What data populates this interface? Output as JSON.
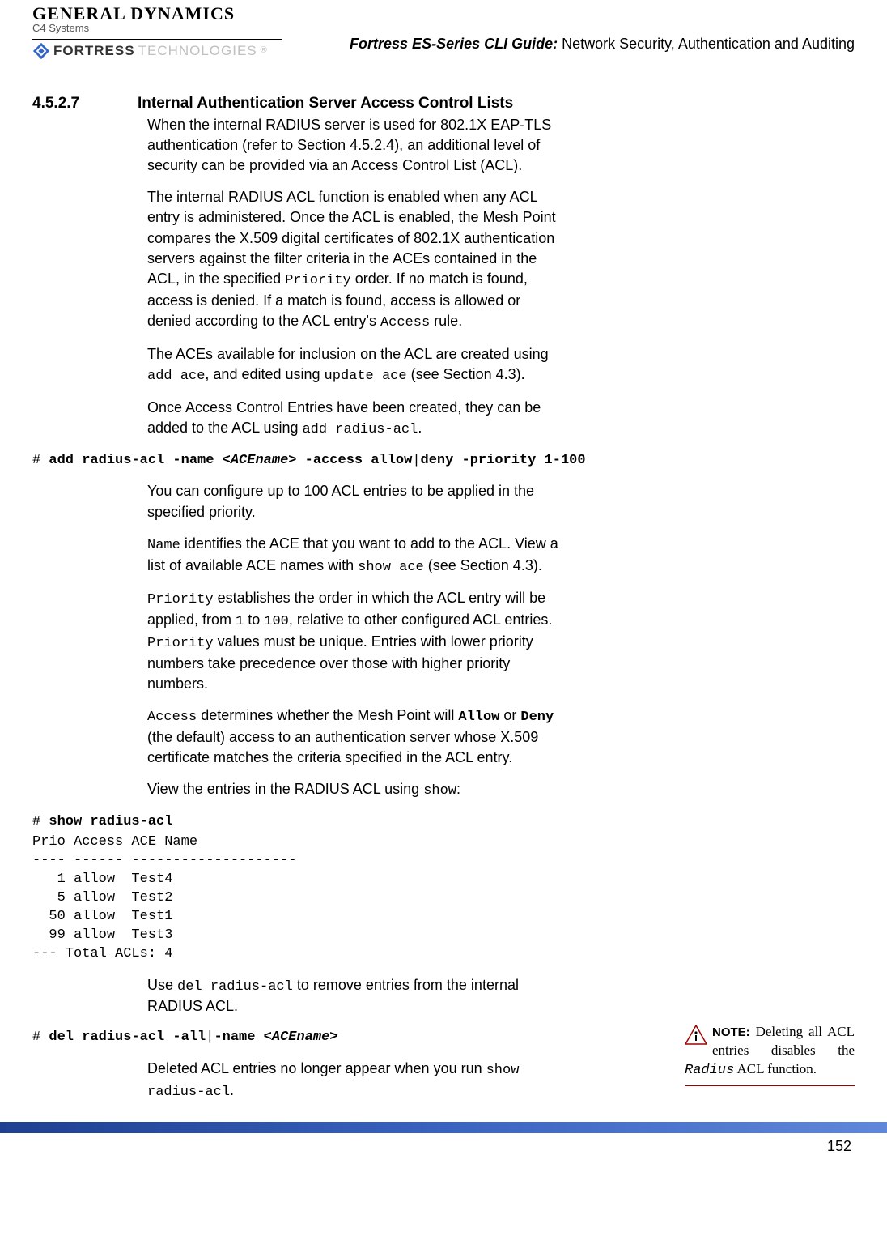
{
  "logos": {
    "gd_main": "GENERAL DYNAMICS",
    "gd_sub": "C4 Systems",
    "fortress": "FORTRESS",
    "fortress_tech": "TECHNOLOGIES",
    "fortress_reg": "®"
  },
  "header": {
    "title_italic": "Fortress ES-Series CLI Guide:",
    "title_rest": " Network Security, Authentication and Auditing"
  },
  "section": {
    "number": "4.5.2.7",
    "title": "Internal Authentication Server Access Control Lists"
  },
  "paras": {
    "p1": "When the internal RADIUS server is used for 802.1X EAP-TLS authentication (refer to Section 4.5.2.4), an additional level of security can be provided via an Access Control List (ACL).",
    "p2a": "The internal RADIUS ACL function is enabled when any ACL entry is administered. Once the ACL is enabled, the Mesh Point compares the X.509 digital certificates of 802.1X authentication servers against the filter criteria in the ACEs contained in the ACL, in the specified ",
    "p2b": " order. If no match is found, access is denied. If a match is found, access is allowed or denied according to the ACL entry's ",
    "p2c": " rule.",
    "p3a": "The ACEs available for inclusion on the ACL are created using ",
    "p3b": ", and edited using ",
    "p3c": " (see Section 4.3).",
    "p4a": "Once Access Control Entries have been created, they can be added to the ACL using ",
    "p4b": ".",
    "p5": "You can configure up to 100 ACL entries to be applied in the specified priority.",
    "p6a_code": "Name",
    "p6a": " identifies the ACE that you want to add to the ACL. View a list of available ACE names with ",
    "p6b": " (see Section 4.3).",
    "p7a_code": "Priority",
    "p7a": " establishes the order in which the ACL entry will be applied, from ",
    "p7b": " to ",
    "p7c": ", relative to other configured ACL entries. ",
    "p7d": " values must be unique. Entries with lower priority numbers take precedence over those with higher priority numbers.",
    "p8a_code": "Access",
    "p8a": " determines whether the Mesh Point will ",
    "p8b": " or ",
    "p8c": " (the default) access to an authentication server whose X.509 certificate matches the criteria specified in the ACL entry.",
    "p9a": "View the entries in the RADIUS ACL using ",
    "p9b": ":",
    "p10a": "Use ",
    "p10b": " to remove entries from the internal RADIUS ACL.",
    "p11a": "Deleted ACL entries no longer appear when you run ",
    "p11b": "."
  },
  "codes": {
    "priority": "Priority",
    "access": "Access",
    "add_ace": "add ace",
    "update_ace": "update ace",
    "add_radius_acl": "add radius-acl",
    "show_ace": "show ace",
    "one": "1",
    "hundred": "100",
    "allow": "Allow",
    "deny": "Deny",
    "show": "show",
    "del_radius_acl": "del radius-acl",
    "show_radius_acl": "show radius-acl"
  },
  "cli": {
    "line1_prompt": "# ",
    "line1_cmd1": "add radius-acl -name ",
    "line1_arg": "<ACEname>",
    "line1_cmd2": " -access allow",
    "line1_pipe": "|",
    "line1_cmd3": "deny -priority 1-100",
    "line2_prompt": "# ",
    "line2_cmd": "show radius-acl",
    "output": "Prio Access ACE Name\n---- ------ --------------------\n   1 allow  Test4\n   5 allow  Test2\n  50 allow  Test1\n  99 allow  Test3\n--- Total ACLs: 4",
    "line3_prompt": "# ",
    "line3_cmd1": "del radius-acl -all",
    "line3_pipe": "|",
    "line3_cmd2": "-name ",
    "line3_arg": "<ACEname>"
  },
  "note": {
    "label": "NOTE:",
    "text_a": " Deleting all ACL entries disables the ",
    "text_code": "Radius",
    "text_b": " ACL function."
  },
  "chart_data": {
    "type": "table",
    "title": "show radius-acl output",
    "columns": [
      "Prio",
      "Access",
      "ACE Name"
    ],
    "rows": [
      [
        1,
        "allow",
        "Test4"
      ],
      [
        5,
        "allow",
        "Test2"
      ],
      [
        50,
        "allow",
        "Test1"
      ],
      [
        99,
        "allow",
        "Test3"
      ]
    ],
    "footer": "--- Total ACLs: 4"
  },
  "footer": {
    "page_number": "152"
  }
}
